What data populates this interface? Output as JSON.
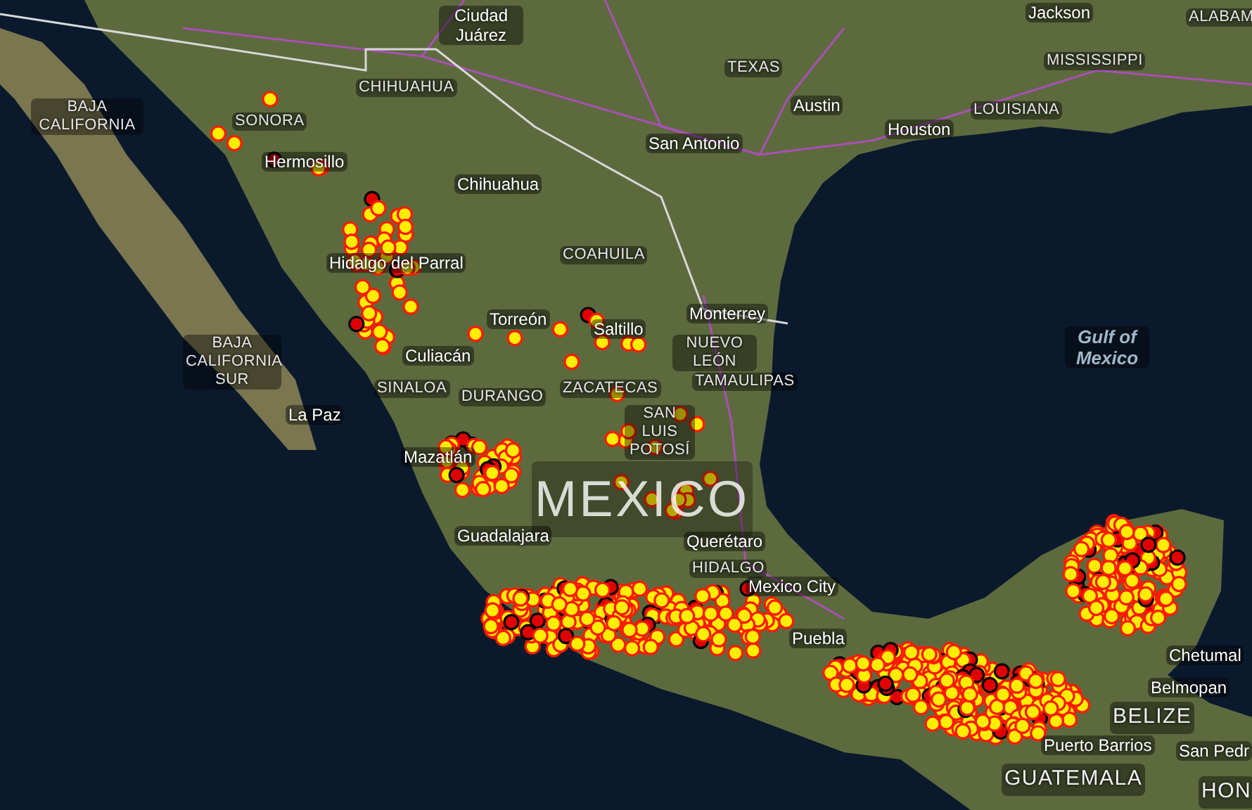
{
  "map": {
    "labels": [
      {
        "text": "Ciudad Juárez",
        "kind": "city"
      },
      {
        "text": "Jackson",
        "kind": "city"
      },
      {
        "text": "ALABAM",
        "kind": "region"
      },
      {
        "text": "TEXAS",
        "kind": "region"
      },
      {
        "text": "MISSISSIPPI",
        "kind": "region"
      },
      {
        "text": "CHIHUAHUA",
        "kind": "region"
      },
      {
        "text": "BAJA CALIFORNIA",
        "kind": "region"
      },
      {
        "text": "Austin",
        "kind": "city"
      },
      {
        "text": "LOUISIANA",
        "kind": "region"
      },
      {
        "text": "SONORA",
        "kind": "region"
      },
      {
        "text": "Houston",
        "kind": "city"
      },
      {
        "text": "San Antonio",
        "kind": "city"
      },
      {
        "text": "Hermosillo",
        "kind": "city"
      },
      {
        "text": "Chihuahua",
        "kind": "city"
      },
      {
        "text": "Hidalgo del Parral",
        "kind": "city"
      },
      {
        "text": "COAHUILA",
        "kind": "region"
      },
      {
        "text": "Torreón",
        "kind": "city"
      },
      {
        "text": "Saltillo",
        "kind": "city"
      },
      {
        "text": "Monterrey",
        "kind": "city"
      },
      {
        "text": "BAJA CALIFORNIA SUR",
        "kind": "region"
      },
      {
        "text": "Culiacán",
        "kind": "city"
      },
      {
        "text": "NUEVO LEÓN",
        "kind": "region"
      },
      {
        "text": "Gulf of Mexico",
        "kind": "water"
      },
      {
        "text": "SINALOA",
        "kind": "region"
      },
      {
        "text": "DURANGO",
        "kind": "region"
      },
      {
        "text": "ZACATECAS",
        "kind": "region"
      },
      {
        "text": "TAMAULIPAS",
        "kind": "region"
      },
      {
        "text": "La Paz",
        "kind": "city"
      },
      {
        "text": "SAN LUIS POTOSÍ",
        "kind": "region"
      },
      {
        "text": "Mazatlán",
        "kind": "city"
      },
      {
        "text": "MEXICO",
        "kind": "country"
      },
      {
        "text": "Guadalajara",
        "kind": "city"
      },
      {
        "text": "Querétaro",
        "kind": "city"
      },
      {
        "text": "HIDALGO",
        "kind": "region"
      },
      {
        "text": "Mexico City",
        "kind": "city"
      },
      {
        "text": "Puebla",
        "kind": "city"
      },
      {
        "text": "Chetumal",
        "kind": "city"
      },
      {
        "text": "Belmopan",
        "kind": "city"
      },
      {
        "text": "BELIZE",
        "kind": "country"
      },
      {
        "text": "Puerto Barrios",
        "kind": "city"
      },
      {
        "text": "San Pedr",
        "kind": "city"
      },
      {
        "text": "GUATEMALA",
        "kind": "country"
      },
      {
        "text": "HON",
        "kind": "country"
      }
    ]
  }
}
